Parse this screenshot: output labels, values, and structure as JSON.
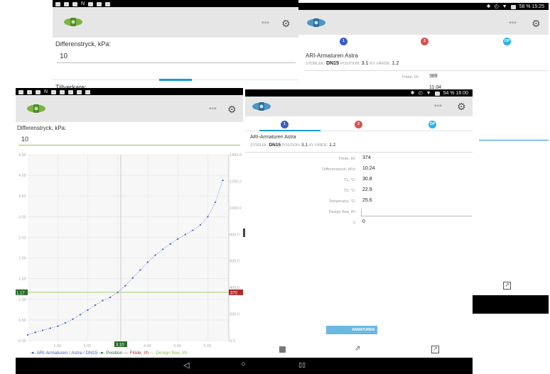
{
  "window_a": {
    "field_label": "Differenstryck, kPa:",
    "field_value": "10",
    "manufacturer_label": "Tillverkare:"
  },
  "window_b": {
    "status_right": "58 % 15:25",
    "circle1": "1",
    "circle2": "2",
    "circle3": "DP",
    "valve_name": "ARI-Armaturen Astra",
    "size_label": "STORLEK:",
    "size_value": "DN15",
    "position_label": "POSITION:",
    "position_value": "3.1",
    "kv_label": "KV VÄRDE:",
    "kv_value": "1.2",
    "flow_label": "Flöde, l/h:",
    "flow_value": "389",
    "partial_value": "11.04"
  },
  "window_c": {
    "field_label": "Differenstryck, kPa:",
    "field_value": "10",
    "y_ticks": [
      "4.50",
      "4.00",
      "3.50",
      "3.00",
      "2.50",
      "2.00",
      "1.50",
      "1.00",
      "0.50",
      "0.00"
    ],
    "y2_ticks": [
      "1400.0",
      "1200.0",
      "1000.0",
      "800.0",
      "600.0",
      "400.0",
      "200.0",
      "0.0"
    ],
    "x_ticks": [
      "1.00",
      "2.00",
      "3.00",
      "4.00",
      "5.00",
      "6.00"
    ],
    "cursor_x_label": "3.10",
    "cursor_y_label": "1.17",
    "cursor_y2_label": "370",
    "legend_series": "ARI-Armaturen / Astra / DN15",
    "legend_position": "Position",
    "legend_flow": "Flöde, l/h",
    "legend_design": "Design flow, l/h"
  },
  "chart_data": {
    "type": "line",
    "x": [
      0.0,
      0.25,
      0.5,
      0.75,
      1.0,
      1.25,
      1.5,
      1.75,
      2.0,
      2.25,
      2.5,
      2.75,
      3.0,
      3.25,
      3.5,
      3.75,
      4.0,
      4.25,
      4.5,
      4.75,
      5.0,
      5.25,
      5.5,
      5.75,
      6.0,
      6.25,
      6.5
    ],
    "series": [
      {
        "name": "ARI-Armaturen / Astra / DN15",
        "values": [
          0.14,
          0.2,
          0.25,
          0.3,
          0.35,
          0.43,
          0.52,
          0.63,
          0.74,
          0.86,
          0.97,
          1.05,
          1.17,
          1.33,
          1.52,
          1.71,
          1.9,
          2.07,
          2.21,
          2.34,
          2.46,
          2.57,
          2.67,
          2.8,
          3.0,
          3.35,
          3.88
        ]
      }
    ],
    "ylim": [
      0,
      4.5
    ],
    "y2lim": [
      0,
      1400
    ],
    "xlim": [
      0,
      6.7
    ],
    "cursor": {
      "x": 3.1,
      "y": 1.17,
      "y2": 370
    },
    "grid": true,
    "legend": "bottom"
  },
  "window_d": {
    "status_right": "54 % 16:00",
    "circle1": "1",
    "circle2": "2",
    "circle3": "DP",
    "valve_name": "ARI-Armaturen Astra",
    "size_label": "STORLEK:",
    "size_value": "DN15",
    "position_label": "POSITION:",
    "position_value": "3.1",
    "kv_label": "KV VÄRDE:",
    "kv_value": "1.2",
    "rows": [
      {
        "label": "Flöde, l/h:",
        "value": "374"
      },
      {
        "label": "Differenstryck, kPa:",
        "value": "10.24"
      },
      {
        "label": "T1, °C:",
        "value": "30.8"
      },
      {
        "label": "T2, °C:",
        "value": "22.9"
      },
      {
        "label": "Temperatur, °C:",
        "value": "25.6"
      },
      {
        "label": "Design flow, l/h:",
        "value": ""
      },
      {
        "label": "λ:",
        "value": "0"
      }
    ],
    "brand": "ARMATUREN"
  },
  "colors": {
    "accent": "#1a9bd7",
    "green": "#6fa33a",
    "red": "#d9534f",
    "blue": "#3a5bc7",
    "cyan": "#2ab3e8"
  }
}
